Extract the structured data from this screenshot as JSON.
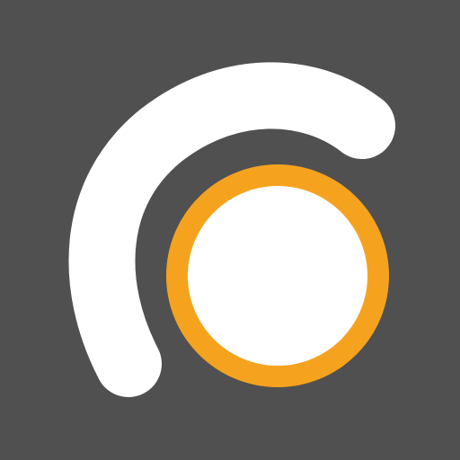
{
  "icon": {
    "name": "app-logo-icon",
    "colors": {
      "background": "#505050",
      "arc": "#ffffff",
      "ring": "#f5a31f",
      "core": "#ffffff"
    }
  }
}
